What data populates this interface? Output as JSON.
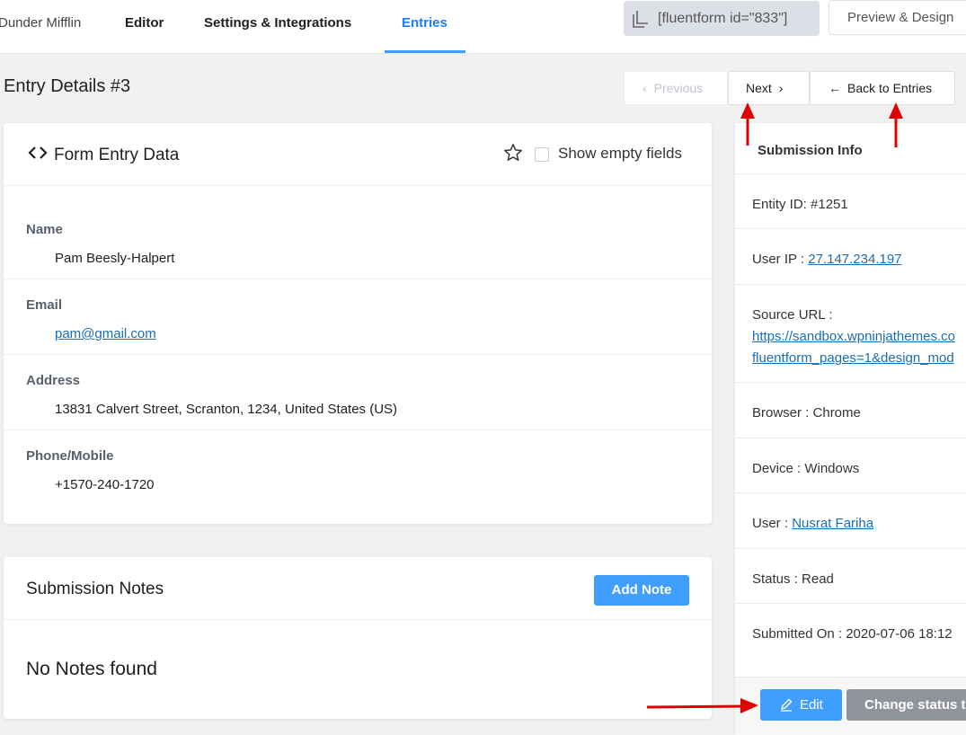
{
  "nav": {
    "brand": "Dunder Mifflin",
    "tabs": [
      {
        "label": "Editor",
        "active": false
      },
      {
        "label": "Settings & Integrations",
        "active": false
      },
      {
        "label": "Entries",
        "active": true
      }
    ],
    "shortcode": "[fluentform id=\"833\"]",
    "preview_label": "Preview & Design"
  },
  "page": {
    "title": "Entry Details #3",
    "previous_label": "Previous",
    "next_label": "Next",
    "back_label": "Back to Entries"
  },
  "entry_card": {
    "title": "Form Entry Data",
    "show_empty_label": "Show empty fields",
    "show_empty_checked": false,
    "fields": [
      {
        "label": "Name",
        "value": "Pam Beesly-Halpert",
        "link": false
      },
      {
        "label": "Email",
        "value": "pam@gmail.com",
        "link": true
      },
      {
        "label": "Address",
        "value": "13831 Calvert Street, Scranton, 1234, United States (US)",
        "link": false
      },
      {
        "label": "Phone/Mobile",
        "value": "+1570-240-1720",
        "link": false
      }
    ]
  },
  "notes_card": {
    "title": "Submission Notes",
    "add_label": "Add Note",
    "empty_text": "No Notes found"
  },
  "submission_info": {
    "title": "Submission Info",
    "entity_id": "Entity ID: #1251",
    "user_ip_label": "User IP : ",
    "user_ip": "27.147.234.197",
    "source_url_label": "Source URL :",
    "source_url_line1": "https://sandbox.wpninjathemes.co",
    "source_url_line2": "fluentform_pages=1&design_mod",
    "browser": "Browser : Chrome",
    "device": "Device : Windows",
    "user_label": "User : ",
    "user": "Nusrat Fariha",
    "status": "Status : Read",
    "submitted_on": "Submitted On : 2020-07-06 18:12",
    "edit_label": "Edit",
    "change_status_label": "Change status to"
  },
  "colors": {
    "accent": "#409eff",
    "link": "#1a6eb2",
    "annotation_arrow": "#e00000"
  }
}
